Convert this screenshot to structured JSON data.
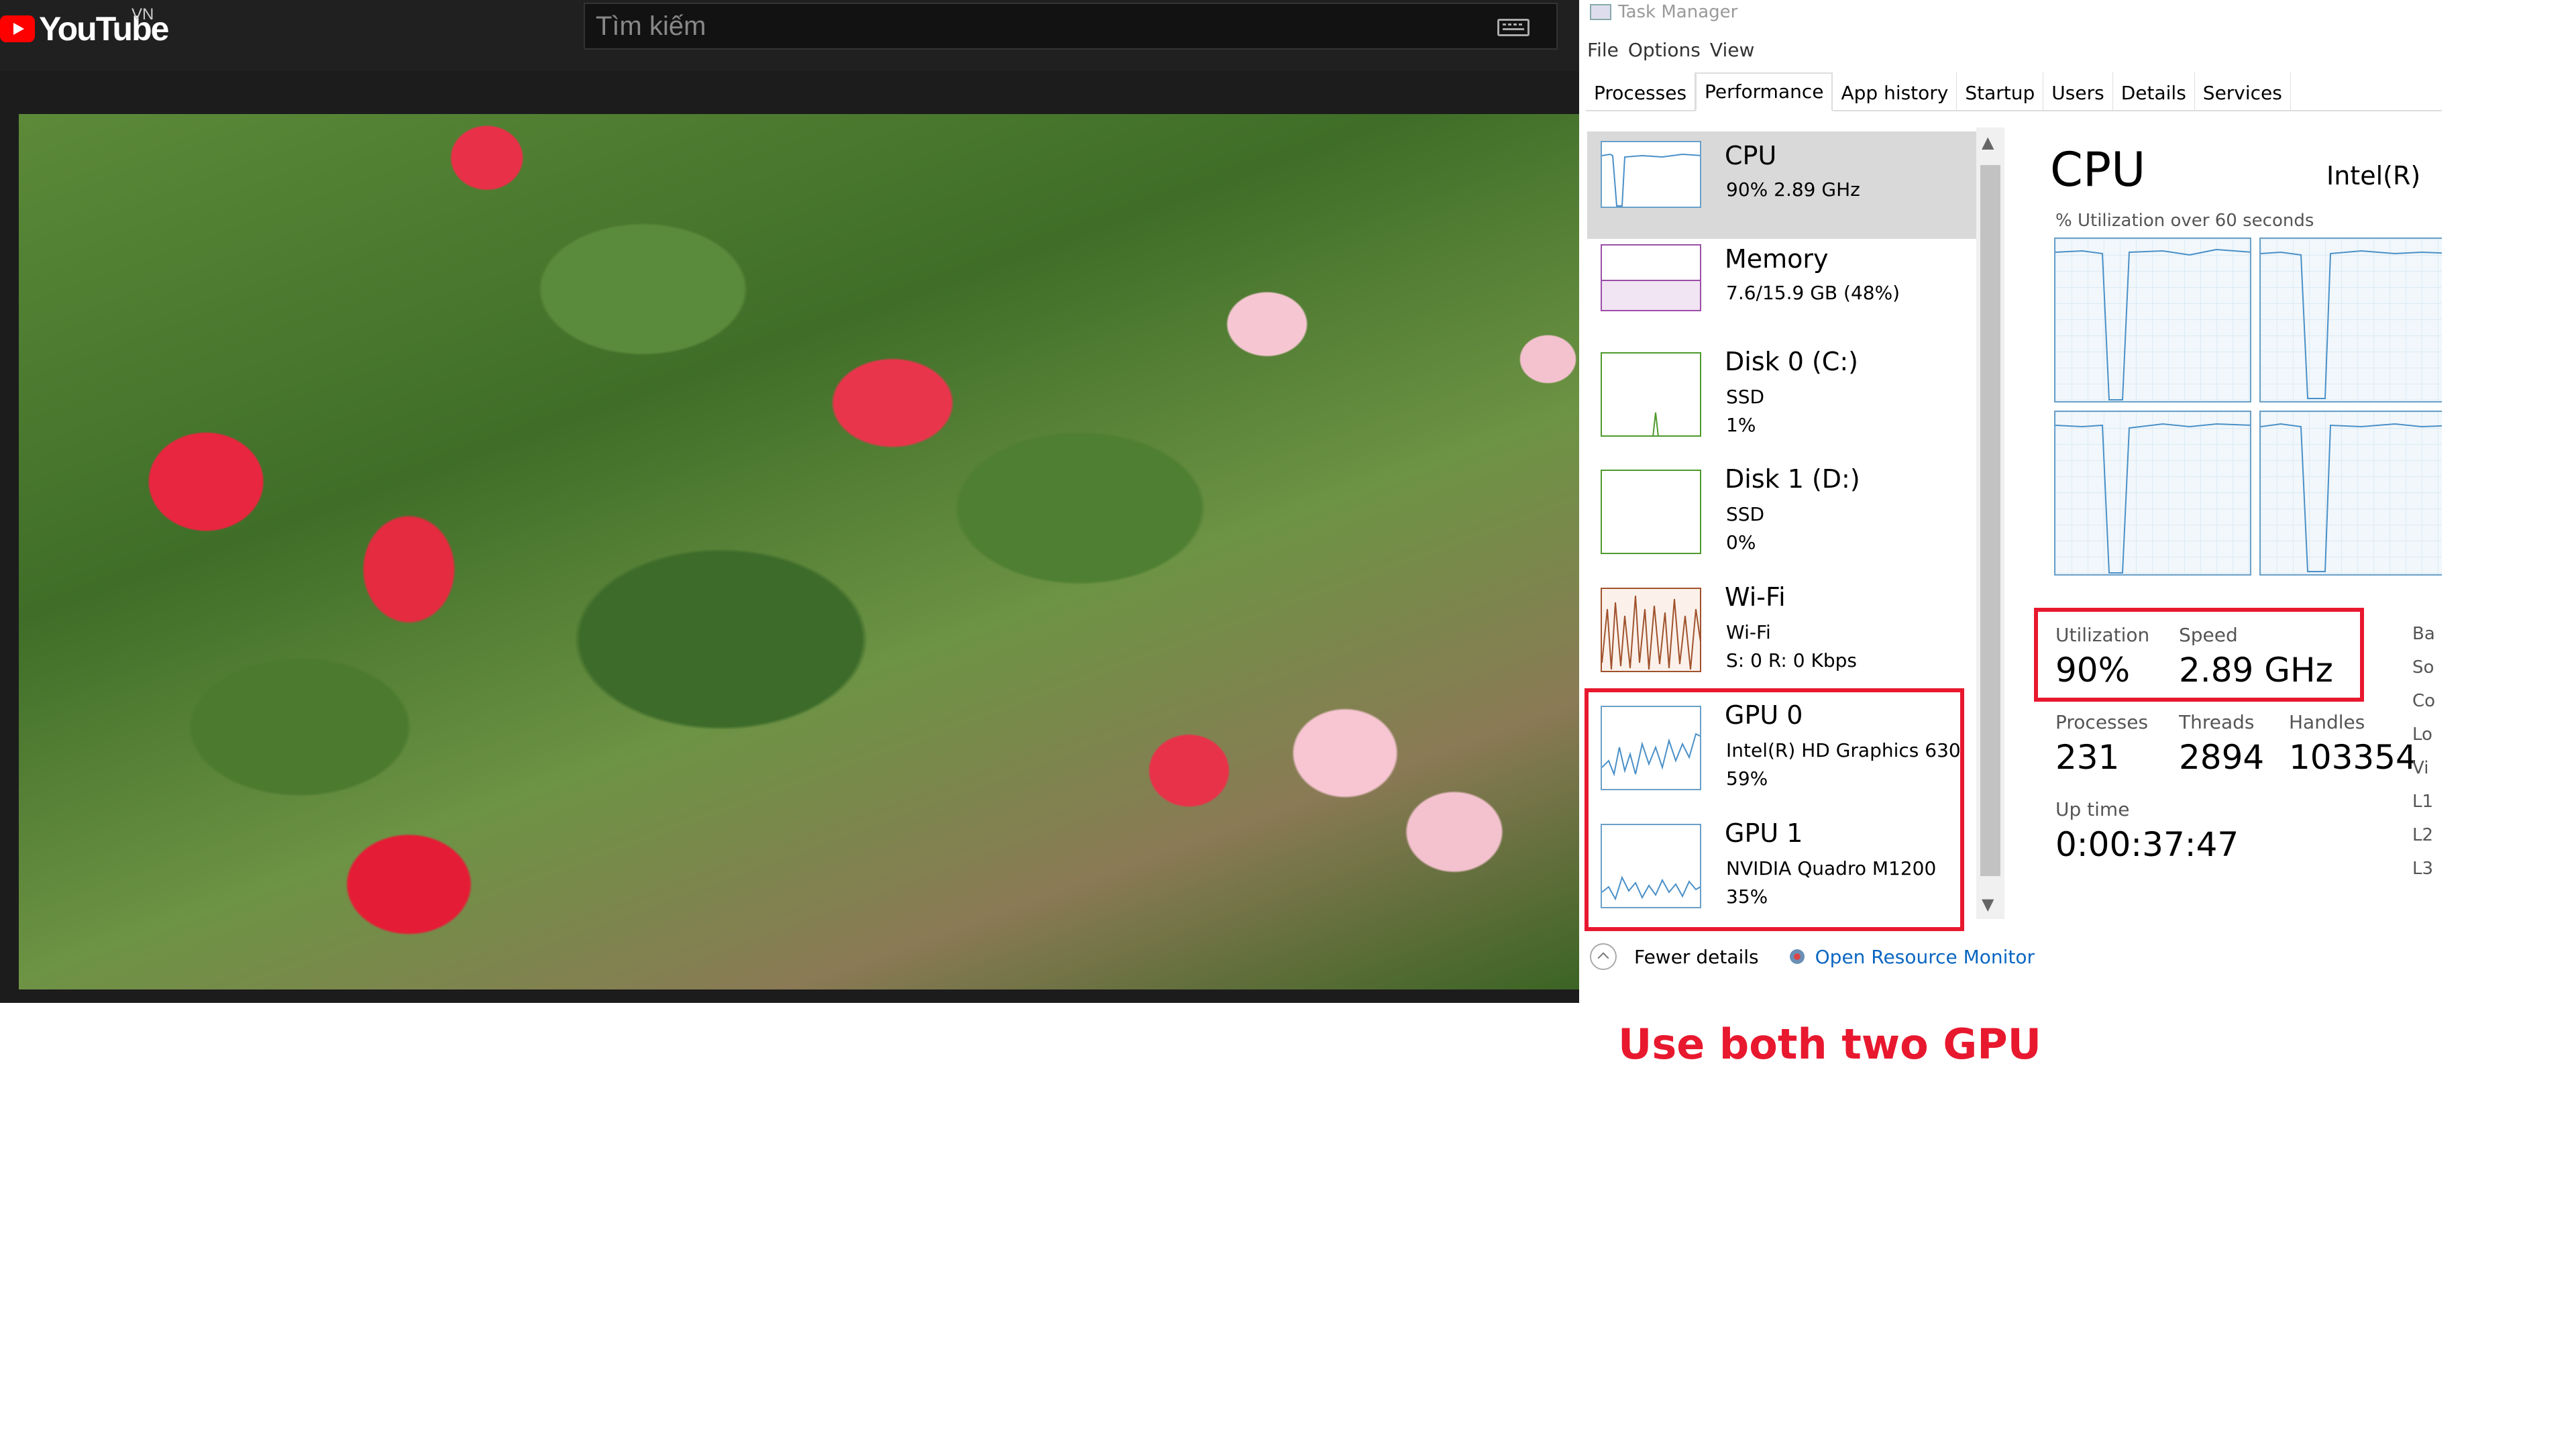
{
  "youtube": {
    "logo_text": "YouTube",
    "region": "VN",
    "search_placeholder": "Tìm kiếm"
  },
  "task_manager": {
    "title": "Task Manager",
    "menu": [
      "File",
      "Options",
      "View"
    ],
    "tabs": [
      "Processes",
      "Performance",
      "App history",
      "Startup",
      "Users",
      "Details",
      "Services"
    ],
    "active_tab": "Performance",
    "items": [
      {
        "title": "CPU",
        "lines": [
          "90%  2.89 GHz"
        ],
        "thumb_color": "#4a90c8"
      },
      {
        "title": "Memory",
        "lines": [
          "7.6/15.9 GB (48%)"
        ],
        "thumb_color": "#9b4fa8"
      },
      {
        "title": "Disk 0 (C:)",
        "lines": [
          "SSD",
          "1%"
        ],
        "thumb_color": "#4e9a2c"
      },
      {
        "title": "Disk 1 (D:)",
        "lines": [
          "SSD",
          "0%"
        ],
        "thumb_color": "#4e9a2c"
      },
      {
        "title": "Wi-Fi",
        "lines": [
          "Wi-Fi",
          "S: 0  R: 0 Kbps"
        ],
        "thumb_color": "#a0522d"
      },
      {
        "title": "GPU 0",
        "lines": [
          "Intel(R) HD Graphics 630",
          "59%"
        ],
        "thumb_color": "#4a90c8"
      },
      {
        "title": "GPU 1",
        "lines": [
          "NVIDIA Quadro M1200",
          "35%"
        ],
        "thumb_color": "#4a90c8"
      }
    ],
    "footer": {
      "fewer_details": "Fewer details",
      "open_monitor": "Open Resource Monitor"
    },
    "detail": {
      "heading": "CPU",
      "model": "Intel(R) Core",
      "graph_caption": "% Utilization over 60 seconds",
      "utilization_label": "Utilization",
      "utilization_value": "90%",
      "speed_label": "Speed",
      "speed_value": "2.89 GHz",
      "processes_label": "Processes",
      "processes_value": "231",
      "threads_label": "Threads",
      "threads_value": "2894",
      "handles_label": "Handles",
      "handles_value": "103354",
      "uptime_label": "Up time",
      "uptime_value": "0:00:37:47",
      "side_labels": [
        "Ba",
        "So",
        "Co",
        "Lo",
        "Vi",
        "L1",
        "L2",
        "L3"
      ]
    }
  },
  "annotation": "Use both two GPU"
}
